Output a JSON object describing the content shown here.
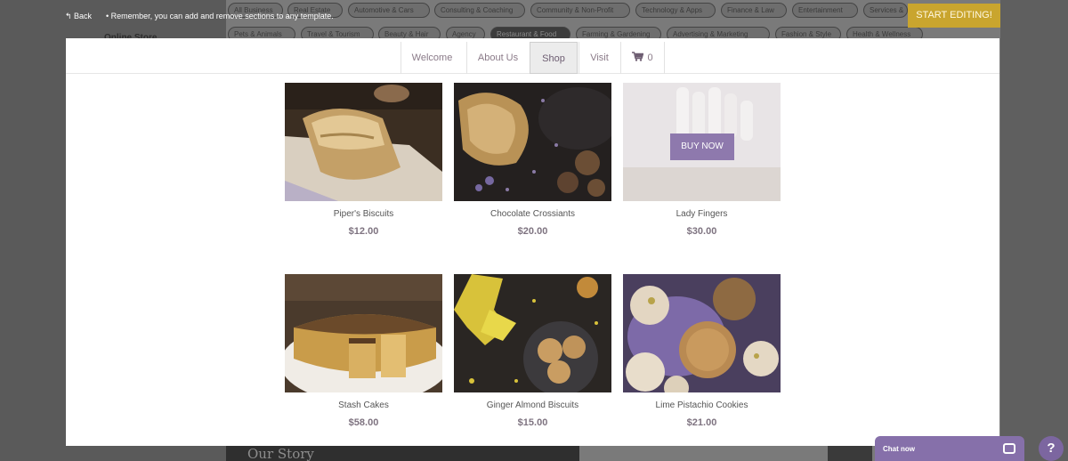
{
  "topbar": {
    "back_label": "↰ Back",
    "remember_text": "•  Remember, you can add and remove sections to any template.",
    "start_editing_label": "START EDITING!"
  },
  "categories": [
    "All Business",
    "Real Estate",
    "Automotive & Cars",
    "Consulting & Coaching",
    "Community & Non-Profit",
    "Technology & Apps",
    "Finance & Law",
    "Entertainment",
    "Services &",
    "Pets & Animals",
    "Travel & Tourism",
    "Beauty & Hair",
    "Agency",
    "Restaurant & Food",
    "Farming & Gardening",
    "Advertising & Marketing",
    "Fashion & Style",
    "Health & Wellness"
  ],
  "background": {
    "online_store": "Online Store",
    "our_story": "Our Story"
  },
  "nav": {
    "items": [
      "Welcome",
      "About Us",
      "Shop",
      "Visit"
    ],
    "active": "Shop",
    "cart_count": "0"
  },
  "products": [
    {
      "name": "Piper's Biscuits",
      "price": "$12.00",
      "image": "bread-loaf"
    },
    {
      "name": "Chocolate Crossiants",
      "price": "$20.00",
      "image": "dark-pastry"
    },
    {
      "name": "Lady Fingers",
      "price": "$30.00",
      "image": "white-pastry",
      "hover_label": "BUY NOW"
    },
    {
      "name": "Stash Cakes",
      "price": "$58.00",
      "image": "cheesecake"
    },
    {
      "name": "Ginger Almond Biscuits",
      "price": "$15.00",
      "image": "cookies-plate"
    },
    {
      "name": "Lime Pistachio Cookies",
      "price": "$21.00",
      "image": "round-cookies"
    }
  ],
  "chat": {
    "label": "Chat now"
  },
  "help": {
    "label": "?"
  },
  "colors": {
    "accent_purple": "#8e79ad",
    "start_button": "#c9a52e",
    "price_text": "#7e7380"
  }
}
